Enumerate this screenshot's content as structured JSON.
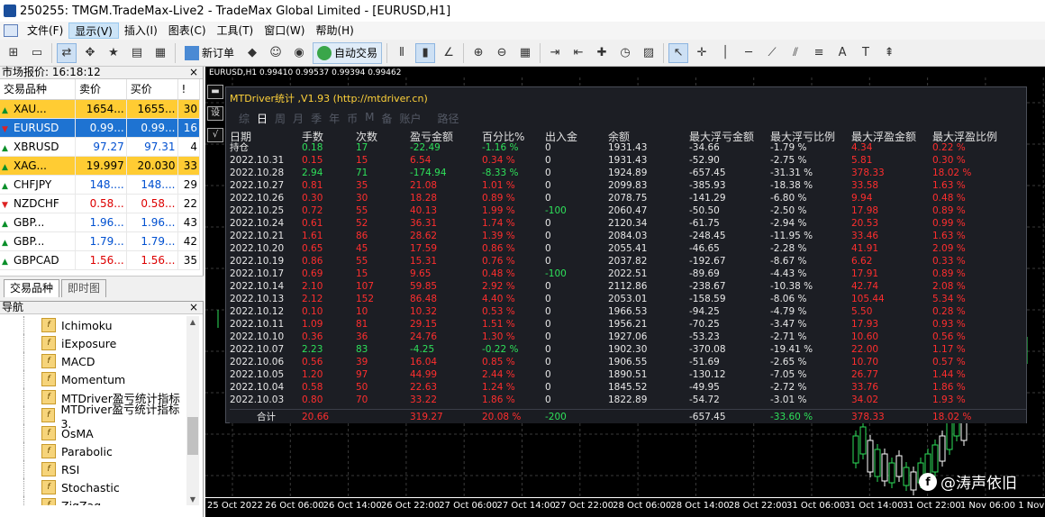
{
  "window": {
    "title": "250255: TMGM.TradeMax-Live2 - TradeMax Global Limited - [EURUSD,H1]"
  },
  "menu": [
    {
      "label": "文件(F)"
    },
    {
      "label": "显示(V)",
      "active": true
    },
    {
      "label": "插入(I)"
    },
    {
      "label": "图表(C)"
    },
    {
      "label": "工具(T)"
    },
    {
      "label": "窗口(W)"
    },
    {
      "label": "帮助(H)"
    }
  ],
  "toolbar": {
    "new_order": "新订单",
    "auto_trade": "自动交易"
  },
  "market_watch": {
    "title": "市场报价: 16:18:12",
    "close": "×",
    "headers": [
      "交易品种",
      "卖价",
      "买价",
      "!"
    ],
    "rows": [
      {
        "symbol": "XAU...",
        "bid": "1654...",
        "ask": "1655...",
        "spread": "30",
        "dir": "up",
        "hl": "orange"
      },
      {
        "symbol": "EURUSD",
        "bid": "0.99...",
        "ask": "0.99...",
        "spread": "16",
        "dir": "dn",
        "hl": "blue"
      },
      {
        "symbol": "XBRUSD",
        "bid": "97.27",
        "ask": "97.31",
        "spread": "4",
        "dir": "up",
        "hl": "",
        "color": "blue"
      },
      {
        "symbol": "XAG...",
        "bid": "19.997",
        "ask": "20.030",
        "spread": "33",
        "dir": "up",
        "hl": "orange"
      },
      {
        "symbol": "CHFJPY",
        "bid": "148....",
        "ask": "148....",
        "spread": "29",
        "dir": "up",
        "hl": "",
        "color": "blue"
      },
      {
        "symbol": "NZDCHF",
        "bid": "0.58...",
        "ask": "0.58...",
        "spread": "22",
        "dir": "dn",
        "hl": "",
        "color": "red"
      },
      {
        "symbol": "GBP...",
        "bid": "1.96...",
        "ask": "1.96...",
        "spread": "43",
        "dir": "up",
        "hl": "",
        "color": "blue"
      },
      {
        "symbol": "GBP...",
        "bid": "1.79...",
        "ask": "1.79...",
        "spread": "42",
        "dir": "up",
        "hl": "",
        "color": "blue"
      },
      {
        "symbol": "GBPCAD",
        "bid": "1.56...",
        "ask": "1.56...",
        "spread": "35",
        "dir": "up",
        "hl": "",
        "color": "red"
      }
    ],
    "tabs": [
      "交易品种",
      "即时图"
    ]
  },
  "navigator": {
    "title": "导航",
    "close": "×",
    "items": [
      "Ichimoku",
      "iExposure",
      "MACD",
      "Momentum",
      "MTDriver盈亏统计指标",
      "MTDriver盈亏统计指标3.",
      "OsMA",
      "Parabolic",
      "RSI",
      "Stochastic",
      "ZigZag"
    ],
    "bottom_tabs": [
      "常用",
      "收藏夹"
    ]
  },
  "chart": {
    "header": "EURUSD,H1  0.99410 0.99537 0.99394 0.99462",
    "x_labels": [
      "25 Oct 2022",
      "26 Oct 06:00",
      "26 Oct 14:00",
      "26 Oct 22:00",
      "27 Oct 06:00",
      "27 Oct 14:00",
      "27 Oct 22:00",
      "28 Oct 06:00",
      "28 Oct 14:00",
      "28 Oct 22:00",
      "31 Oct 06:00",
      "31 Oct 14:00",
      "31 Oct 22:00",
      "1 Nov 06:00",
      "1 Nov 14"
    ]
  },
  "panel": {
    "title": "MTDriver统计 ,V1.93 (http://mtdriver.cn)",
    "periods": [
      "综",
      "日",
      "周",
      "月",
      "季",
      "年",
      "币",
      "M",
      "备",
      "账户",
      "路径"
    ],
    "active_period": "日",
    "headers": [
      "日期",
      "手数",
      "次数",
      "盈亏金额",
      "百分比%",
      "出入金",
      "余额",
      "最大浮亏金额",
      "最大浮亏比例",
      "最大浮盈金额",
      "最大浮盈比例"
    ],
    "rows": [
      [
        "持仓",
        "0.18",
        "17",
        "-22.49",
        "-1.16 %",
        "0",
        "1931.43",
        "-34.66",
        "-1.79 %",
        "4.34",
        "0.22 %"
      ],
      [
        "2022.10.31",
        "0.15",
        "15",
        "6.54",
        "0.34 %",
        "0",
        "1931.43",
        "-52.90",
        "-2.75 %",
        "5.81",
        "0.30 %"
      ],
      [
        "2022.10.28",
        "2.94",
        "71",
        "-174.94",
        "-8.33 %",
        "0",
        "1924.89",
        "-657.45",
        "-31.31 %",
        "378.33",
        "18.02 %"
      ],
      [
        "2022.10.27",
        "0.81",
        "35",
        "21.08",
        "1.01 %",
        "0",
        "2099.83",
        "-385.93",
        "-18.38 %",
        "33.58",
        "1.63 %"
      ],
      [
        "2022.10.26",
        "0.30",
        "30",
        "18.28",
        "0.89 %",
        "0",
        "2078.75",
        "-141.29",
        "-6.80 %",
        "9.94",
        "0.48 %"
      ],
      [
        "2022.10.25",
        "0.72",
        "55",
        "40.13",
        "1.99 %",
        "-100",
        "2060.47",
        "-50.50",
        "-2.50 %",
        "17.98",
        "0.89 %"
      ],
      [
        "2022.10.24",
        "0.61",
        "52",
        "36.31",
        "1.74 %",
        "0",
        "2120.34",
        "-61.75",
        "-2.94 %",
        "20.53",
        "0.99 %"
      ],
      [
        "2022.10.21",
        "1.61",
        "86",
        "28.62",
        "1.39 %",
        "0",
        "2084.03",
        "-248.45",
        "-11.95 %",
        "33.46",
        "1.63 %"
      ],
      [
        "2022.10.20",
        "0.65",
        "45",
        "17.59",
        "0.86 %",
        "0",
        "2055.41",
        "-46.65",
        "-2.28 %",
        "41.91",
        "2.09 %"
      ],
      [
        "2022.10.19",
        "0.86",
        "55",
        "15.31",
        "0.76 %",
        "0",
        "2037.82",
        "-192.67",
        "-8.67 %",
        "6.62",
        "0.33 %"
      ],
      [
        "2022.10.17",
        "0.69",
        "15",
        "9.65",
        "0.48 %",
        "-100",
        "2022.51",
        "-89.69",
        "-4.43 %",
        "17.91",
        "0.89 %"
      ],
      [
        "2022.10.14",
        "2.10",
        "107",
        "59.85",
        "2.92 %",
        "0",
        "2112.86",
        "-238.67",
        "-10.38 %",
        "42.74",
        "2.08 %"
      ],
      [
        "2022.10.13",
        "2.12",
        "152",
        "86.48",
        "4.40 %",
        "0",
        "2053.01",
        "-158.59",
        "-8.06 %",
        "105.44",
        "5.34 %"
      ],
      [
        "2022.10.12",
        "0.10",
        "10",
        "10.32",
        "0.53 %",
        "0",
        "1966.53",
        "-94.25",
        "-4.79 %",
        "5.50",
        "0.28 %"
      ],
      [
        "2022.10.11",
        "1.09",
        "81",
        "29.15",
        "1.51 %",
        "0",
        "1956.21",
        "-70.25",
        "-3.47 %",
        "17.93",
        "0.93 %"
      ],
      [
        "2022.10.10",
        "0.36",
        "36",
        "24.76",
        "1.30 %",
        "0",
        "1927.06",
        "-53.23",
        "-2.71 %",
        "10.60",
        "0.56 %"
      ],
      [
        "2022.10.07",
        "2.23",
        "83",
        "-4.25",
        "-0.22 %",
        "0",
        "1902.30",
        "-370.08",
        "-19.41 %",
        "22.00",
        "1.17 %"
      ],
      [
        "2022.10.06",
        "0.56",
        "39",
        "16.04",
        "0.85 %",
        "0",
        "1906.55",
        "-51.69",
        "-2.65 %",
        "10.70",
        "0.57 %"
      ],
      [
        "2022.10.05",
        "1.20",
        "97",
        "44.99",
        "2.44 %",
        "0",
        "1890.51",
        "-130.12",
        "-7.05 %",
        "26.77",
        "1.44 %"
      ],
      [
        "2022.10.04",
        "0.58",
        "50",
        "22.63",
        "1.24 %",
        "0",
        "1845.52",
        "-49.95",
        "-2.72 %",
        "33.76",
        "1.86 %"
      ],
      [
        "2022.10.03",
        "0.80",
        "70",
        "33.22",
        "1.86 %",
        "0",
        "1822.89",
        "-54.72",
        "-3.01 %",
        "34.02",
        "1.93 %"
      ]
    ],
    "footer": [
      "合计",
      "20.66",
      "",
      "319.27",
      "20.08 %",
      "-200",
      "",
      "-657.45",
      "-33.60 %",
      "378.33",
      "18.02 %"
    ]
  },
  "watermark": "@涛声依旧",
  "colors": {
    "profit": "#2ee05a",
    "loss": "#ff2e2e",
    "title": "#ffd23a",
    "market_hl": "#ffcc33",
    "market_sel": "#1e73d2"
  }
}
